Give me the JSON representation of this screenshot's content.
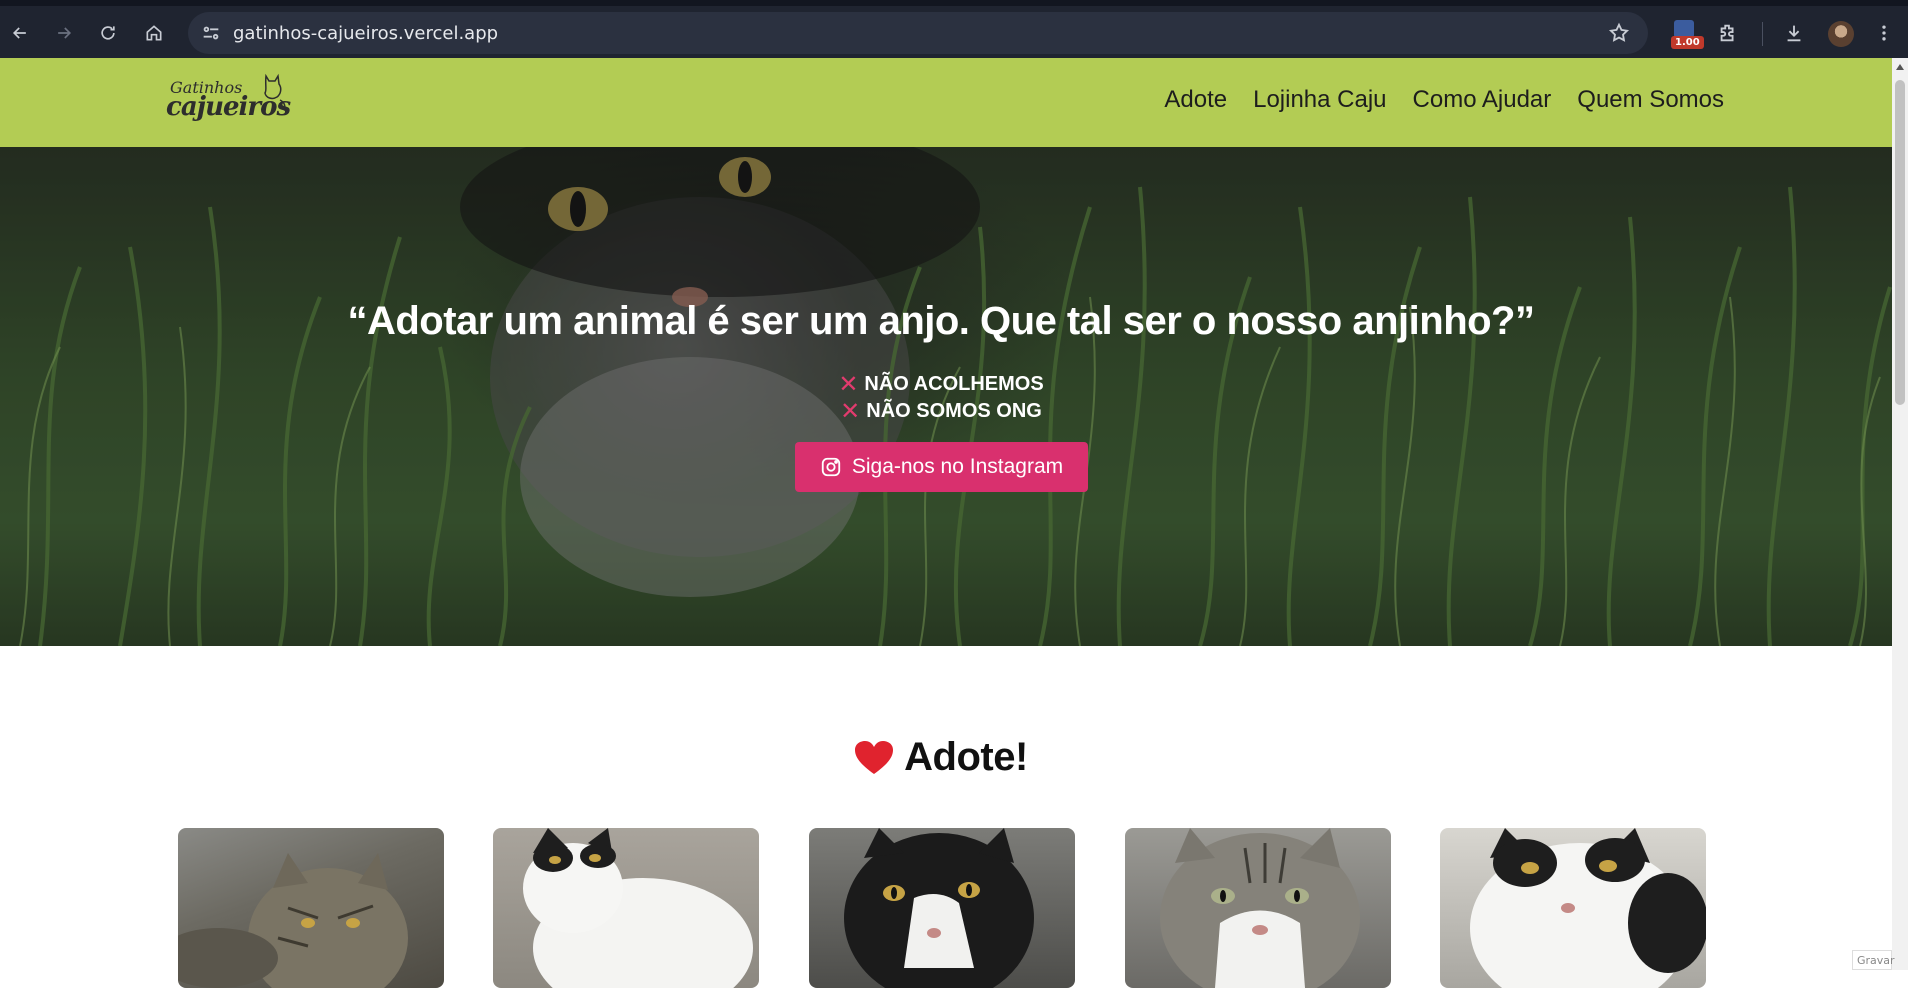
{
  "browser": {
    "url": "gatinhos-cajueiros.vercel.app",
    "extension_badge": "1.00",
    "icons": [
      "back-icon",
      "forward-icon",
      "reload-icon",
      "home-icon",
      "site-settings-icon",
      "star-icon",
      "extensions-icon",
      "download-icon",
      "menu-icon"
    ]
  },
  "header": {
    "logo_line1": "Gatinhos",
    "logo_line2": "cajueiros",
    "menu": [
      {
        "label": "Adote"
      },
      {
        "label": "Lojinha Caju"
      },
      {
        "label": "Como Ajudar"
      },
      {
        "label": "Quem Somos"
      }
    ],
    "background": "#b3cc54"
  },
  "hero": {
    "quote": "“Adotar um animal é ser um anjo. Que tal ser o nosso anjinho?”",
    "notes": [
      {
        "icon": "✕",
        "text": "NÃO ACOLHEMOS"
      },
      {
        "icon": "✕",
        "text": "NÃO SOMOS ONG"
      }
    ],
    "instagram_button": "Siga-nos no Instagram",
    "button_color": "#d9306e"
  },
  "adote": {
    "title": "Adote!",
    "heart_color": "#e0232e",
    "cards": [
      {
        "name": "cat-photo-tabby"
      },
      {
        "name": "cat-photo-white-black-1"
      },
      {
        "name": "cat-photo-tuxedo"
      },
      {
        "name": "cat-photo-gray-tabby-white"
      },
      {
        "name": "cat-photo-white-black-2"
      }
    ]
  },
  "overlay_label": "Gravar"
}
